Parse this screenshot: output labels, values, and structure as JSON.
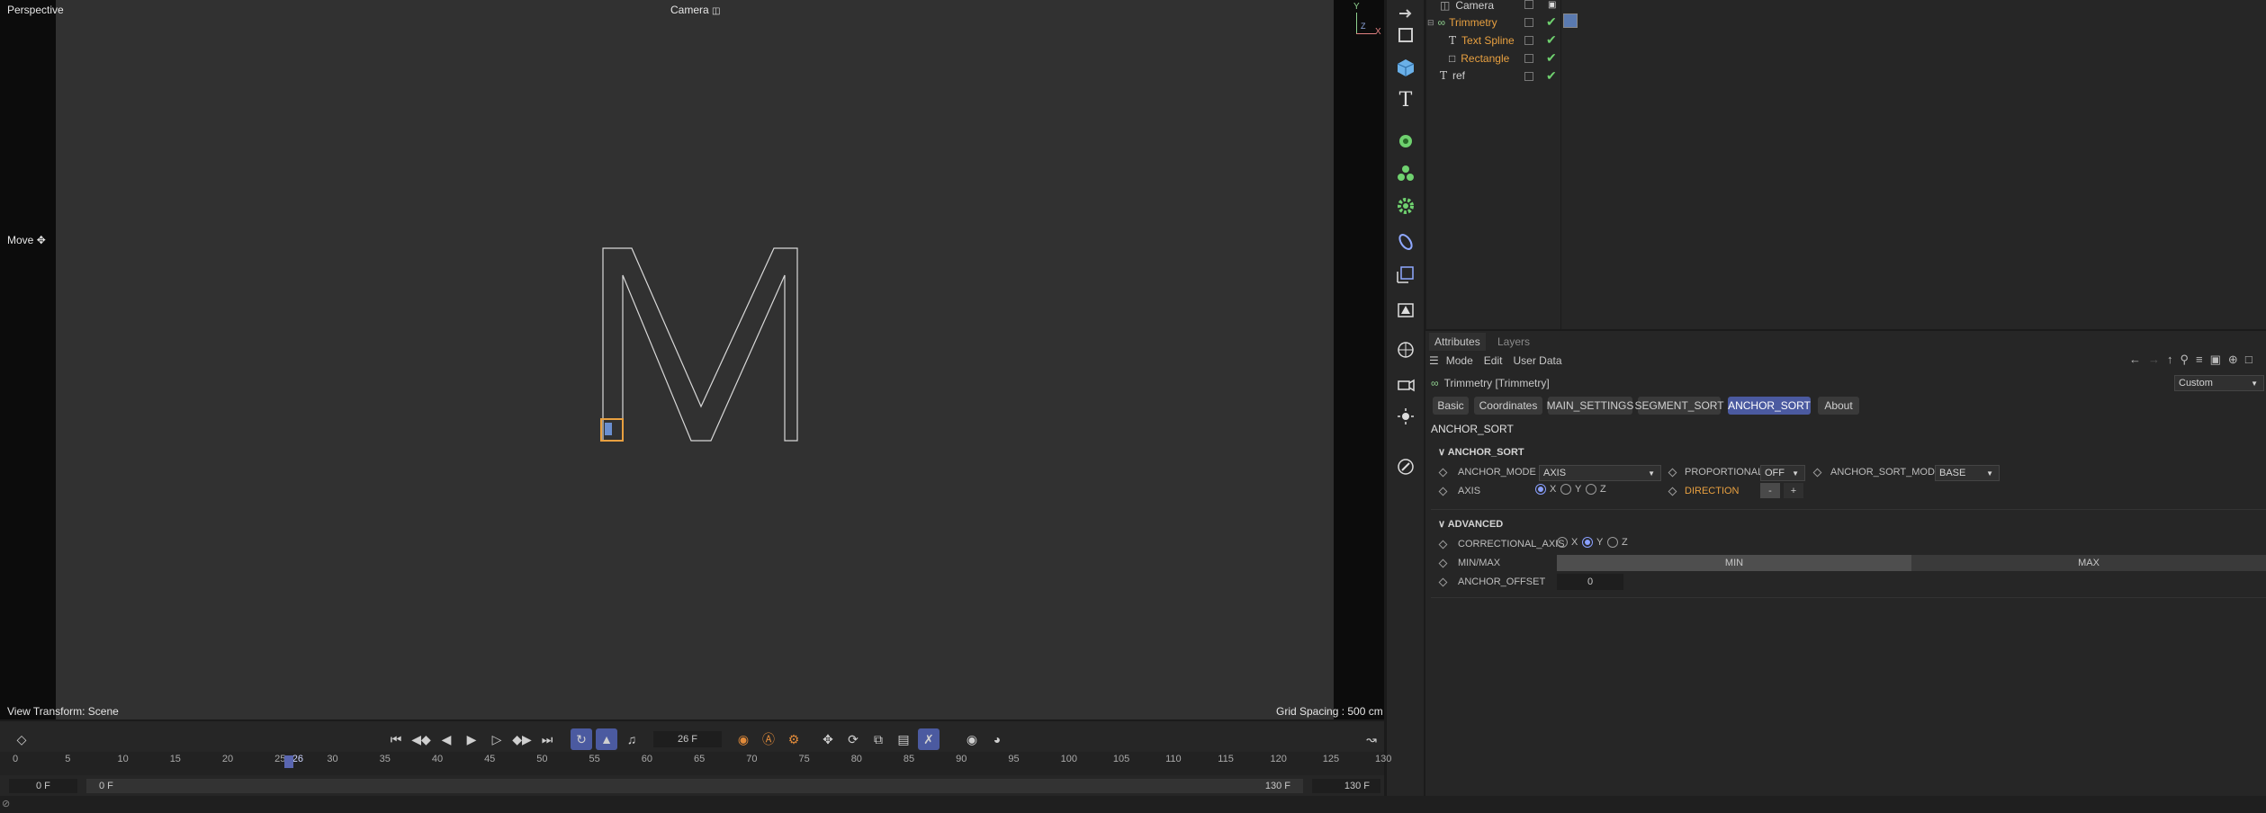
{
  "viewport": {
    "view_name": "Perspective",
    "camera_label": "Camera",
    "tool_label": "Move",
    "transform_label": "View Transform: Scene",
    "grid_label": "Grid Spacing : 500 cm",
    "axis_y": "Y",
    "axis_x": "X",
    "axis_z": "Z",
    "model_letter": "M"
  },
  "object_manager": {
    "rows": [
      {
        "name": "Camera",
        "color": "#cfcfcf"
      },
      {
        "name": "Trimmetry",
        "color": "#e8a040"
      },
      {
        "name": "Text Spline",
        "color": "#e8a040"
      },
      {
        "name": "Rectangle",
        "color": "#e8a040"
      },
      {
        "name": "ref",
        "color": "#cfcfcf"
      }
    ]
  },
  "attributes": {
    "panel_tabs": [
      "Attributes",
      "Layers"
    ],
    "menu": [
      "Mode",
      "Edit",
      "User Data"
    ],
    "object_title": "Trimmetry [Trimmetry]",
    "preset_value": "Custom",
    "tabs": [
      "Basic",
      "Coordinates",
      "MAIN_SETTINGS",
      "SEGMENT_SORT",
      "ANCHOR_SORT",
      "About"
    ],
    "active_tab": "ANCHOR_SORT",
    "section_heading": "ANCHOR_SORT",
    "group_anchor": "ANCHOR_SORT",
    "anchor_mode_label": "ANCHOR_MODE",
    "anchor_mode_value": "AXIS",
    "proportional_label": "PROPORTIONAL",
    "proportional_value": "OFF",
    "anchor_sort_mode_label": "ANCHOR_SORT_MODE",
    "anchor_sort_mode_value": "BASE",
    "axis_label": "AXIS",
    "axis_x": "X",
    "axis_y": "Y",
    "axis_z": "Z",
    "direction_label": "DIRECTION",
    "direction_minus": "-",
    "direction_plus": "+",
    "group_advanced": "ADVANCED",
    "correctional_axis_label": "CORRECTIONAL_AXIS",
    "corr_x": "X",
    "corr_y": "Y",
    "corr_z": "Z",
    "minmax_label": "MIN/MAX",
    "min_label": "MIN",
    "max_label": "MAX",
    "anchor_offset_label": "ANCHOR_OFFSET",
    "anchor_offset_value": "0"
  },
  "timeline": {
    "current_frame": "26 F",
    "start_frame": "0 F",
    "range_start": "0 F",
    "range_end": "130 F",
    "end_frame": "130 F",
    "ticks": [
      "0",
      "5",
      "10",
      "15",
      "20",
      "25",
      "26",
      "30",
      "35",
      "40",
      "45",
      "50",
      "55",
      "60",
      "65",
      "70",
      "75",
      "80",
      "85",
      "90",
      "95",
      "100",
      "105",
      "110",
      "115",
      "120",
      "125",
      "130"
    ]
  },
  "colors": {
    "accent": "#4b5aa0",
    "orange": "#e8a040",
    "check_green": "#6fd16f"
  }
}
